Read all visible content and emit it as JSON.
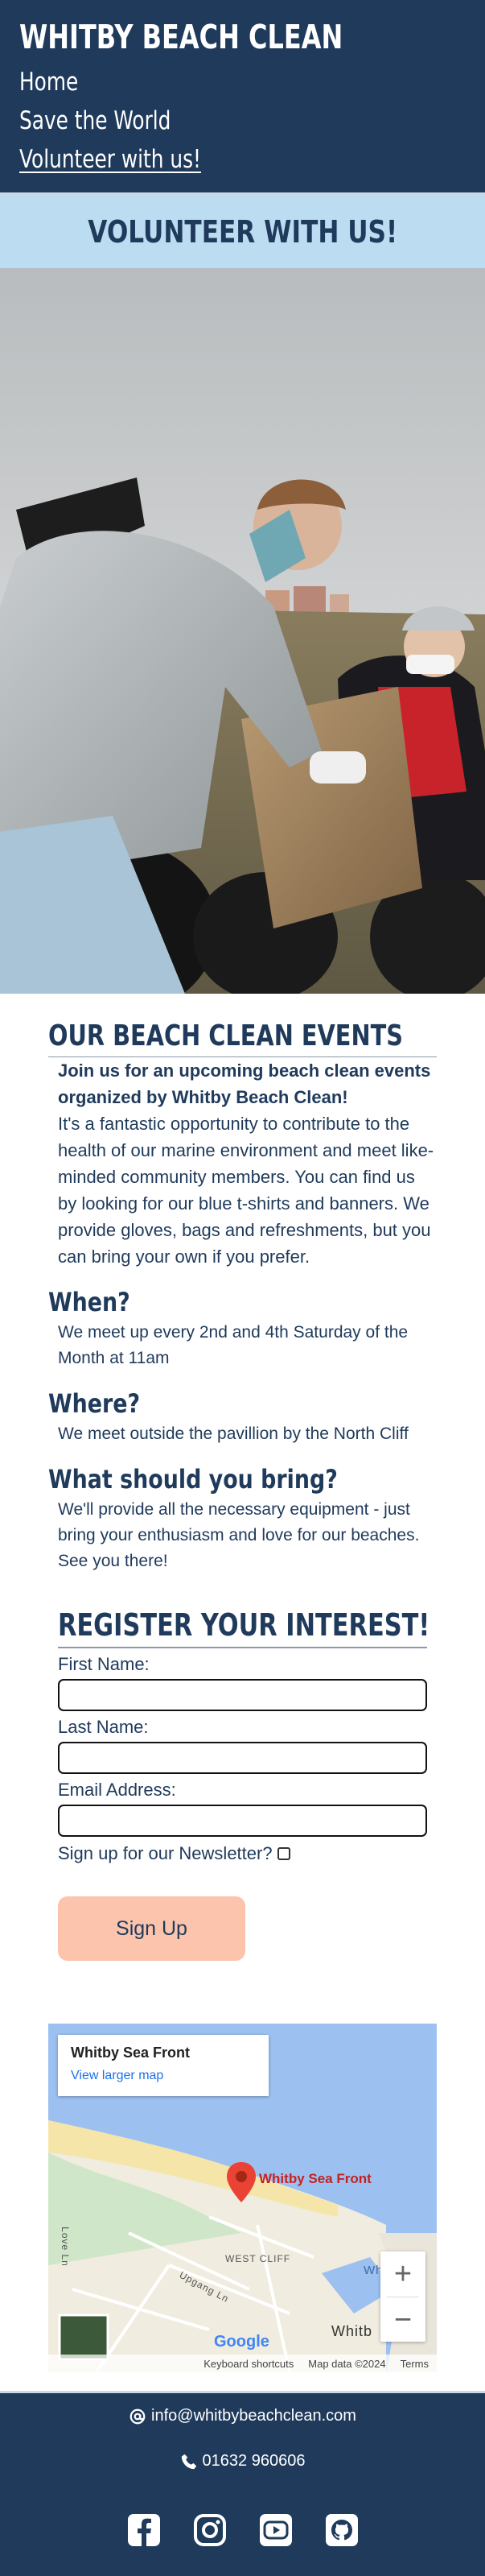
{
  "header": {
    "brand": "WHITBY BEACH CLEAN",
    "nav": [
      {
        "label": "Home"
      },
      {
        "label": "Save the World"
      },
      {
        "label": "Volunteer with us!"
      }
    ]
  },
  "banner": {
    "title": "VOLUNTEER WITH US!"
  },
  "events": {
    "title": "OUR BEACH CLEAN EVENTS",
    "lead": "Join us for an upcoming beach clean events organized by Whitby Beach Clean!",
    "intro": "It's a fantastic opportunity to contribute to the health of our marine environment and meet like-minded community members. You can find us by looking for our blue t-shirts and banners. We provide gloves, bags and refreshments, but you can bring your own if you prefer.",
    "when_title": "When?",
    "when_text": "We meet up every 2nd and 4th Saturday of the Month at 11am",
    "where_title": "Where?",
    "where_text": "We meet outside the pavillion by the North Cliff",
    "bring_title": "What should you bring?",
    "bring_text": "We'll provide all the necessary equipment - just bring your enthusiasm and love for our beaches. See you there!"
  },
  "form": {
    "title": "REGISTER YOUR INTEREST!",
    "first_name_label": "First Name:",
    "last_name_label": "Last Name:",
    "email_label": "Email Address:",
    "newsletter_label": "Sign up for our Newsletter?",
    "submit_label": "Sign Up"
  },
  "map": {
    "place": "Whitby Sea Front",
    "larger_link": "View larger map",
    "pin_label": "Whitby Sea Front",
    "labels": [
      "WEST CLIFF",
      "Upgang Ln",
      "Love Ln",
      "Whitby",
      "Whitb"
    ],
    "google": "Google",
    "footer": [
      "Keyboard shortcuts",
      "Map data ©2024",
      "Terms"
    ],
    "zoom_in": "+",
    "zoom_out": "−"
  },
  "footer": {
    "email": "info@whitbybeachclean.com",
    "phone": "01632 960606",
    "socials": [
      "facebook-icon",
      "instagram-icon",
      "youtube-icon",
      "github-icon"
    ]
  },
  "colors": {
    "navy": "#1f3a5b",
    "banner": "#bcdcf2",
    "button": "#fcc4ad"
  }
}
